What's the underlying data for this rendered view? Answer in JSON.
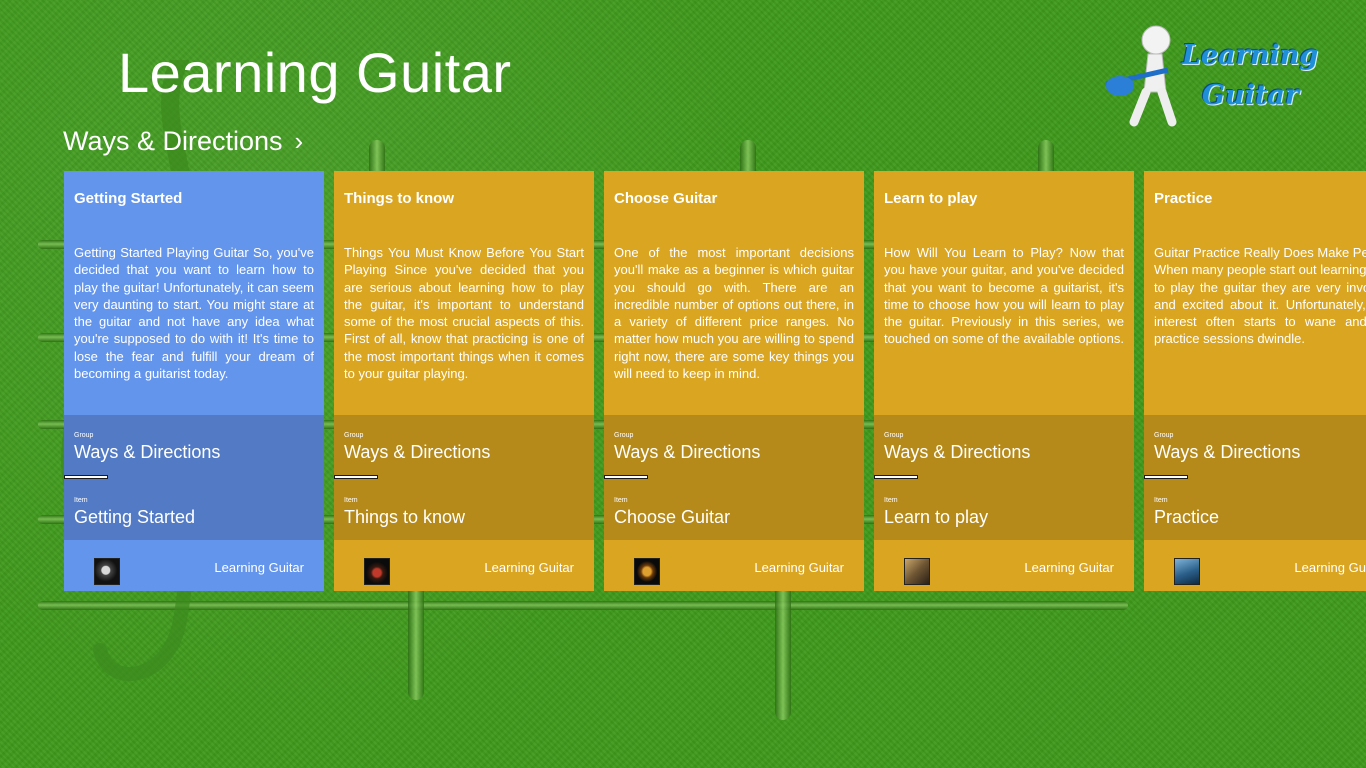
{
  "app": {
    "title": "Learning Guitar"
  },
  "group": {
    "title": "Ways & Directions",
    "chevron": "›"
  },
  "logo": {
    "line1": "Learning",
    "line2": "Guitar"
  },
  "labels": {
    "group": "Group",
    "item": "Item"
  },
  "colors": {
    "blue": "#6495ed",
    "gold": "#daa520",
    "background": "#3f9a1c"
  },
  "cards": [
    {
      "title": "Getting Started",
      "description": "Getting Started Playing Guitar So, you've decided that you want to learn how to play the guitar! Unfortunately, it can seem very daunting to start. You might stare at the guitar and not have any idea what you're supposed to do with it! It's time to lose the fear and fulfill your dream of becoming a guitarist today.",
      "group_name": "Ways & Directions",
      "item_name": "Getting Started",
      "footer": "Learning Guitar",
      "thumbnail_icon": "guitar-thumbnail-icon",
      "color": "#6495ed",
      "progress": 0.17
    },
    {
      "title": "Things to know",
      "description": "Things You Must Know Before You Start Playing Since you've decided that you are serious about learning how to play the guitar, it's important to understand some of the most crucial aspects of this. First of all, know that practicing is one of the most important things when it comes to your guitar playing.",
      "group_name": "Ways & Directions",
      "item_name": "Things to know",
      "footer": "Learning Guitar",
      "thumbnail_icon": "guitar-thumbnail-icon",
      "color": "#daa520",
      "progress": 0.17
    },
    {
      "title": "Choose Guitar",
      "description": "One of the most important decisions you'll make as a beginner is which guitar you should go with. There are an incredible number of options out there, in a variety of different price ranges. No matter how much you are willing to spend right now, there are some key things you will need to keep in mind.",
      "group_name": "Ways & Directions",
      "item_name": "Choose Guitar",
      "footer": "Learning Guitar",
      "thumbnail_icon": "guitar-thumbnail-icon",
      "color": "#daa520",
      "progress": 0.17
    },
    {
      "title": "Learn to play",
      "description": "How Will You Learn to Play? Now that you have your guitar, and you've decided that you want to become a guitarist, it's time to choose how you will learn to play the guitar. Previously in this series, we touched on some of the available options.",
      "group_name": "Ways & Directions",
      "item_name": "Learn to play",
      "footer": "Learning Guitar",
      "thumbnail_icon": "guitar-thumbnail-icon",
      "color": "#daa520",
      "progress": 0.17
    },
    {
      "title": "Practice",
      "description": "Guitar Practice Really Does Make Perfect When many people start out learning how to play the guitar they are very involved and excited about it. Unfortunately, that interest often starts to wane and the practice sessions dwindle.",
      "group_name": "Ways & Directions",
      "item_name": "Practice",
      "footer": "Learning Guitar",
      "thumbnail_icon": "guitar-thumbnail-icon",
      "color": "#daa520",
      "progress": 0.17
    }
  ]
}
